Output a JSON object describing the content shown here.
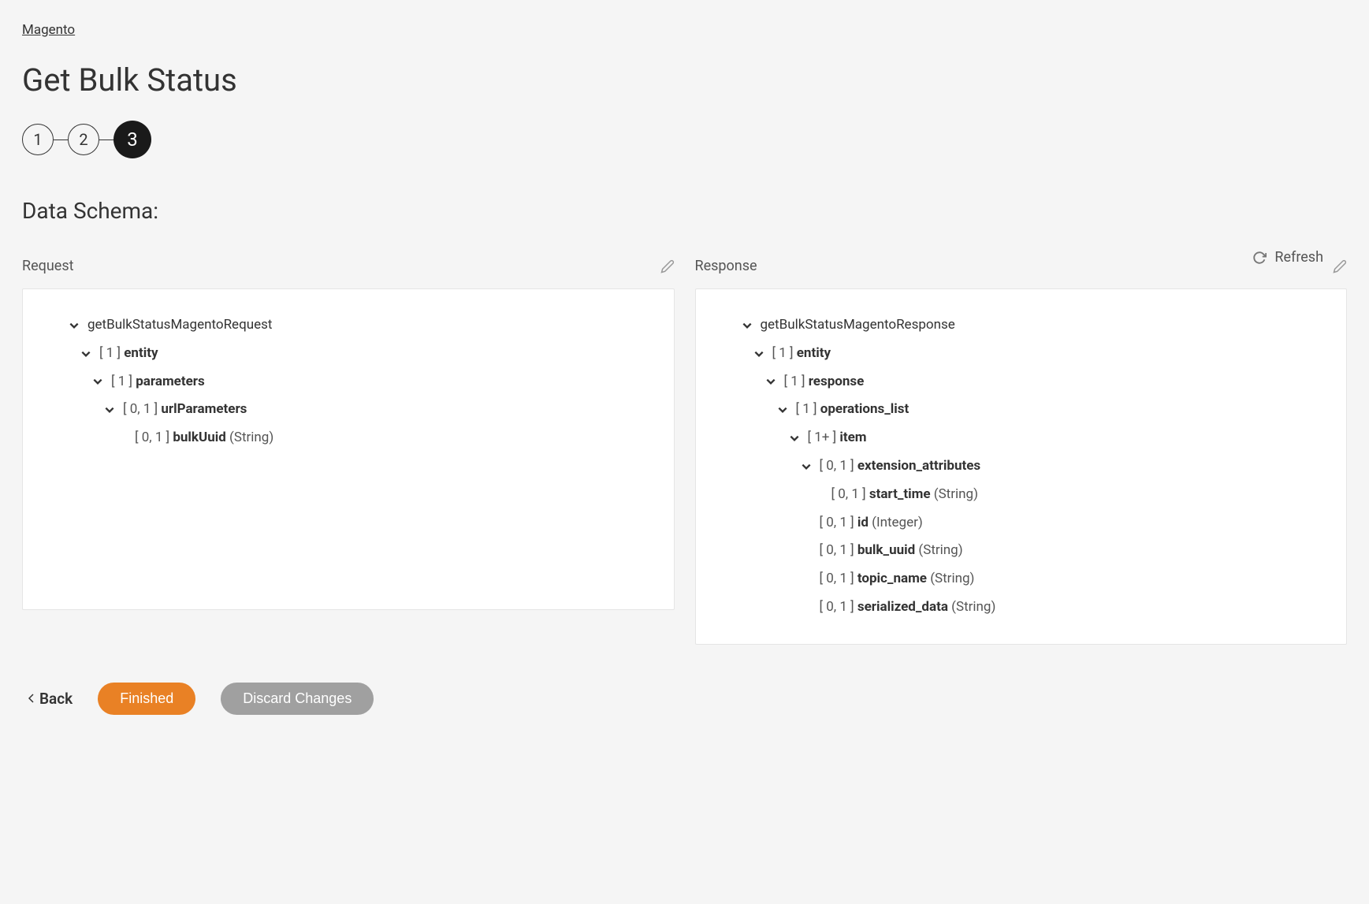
{
  "breadcrumb": "Magento",
  "page_title": "Get Bulk Status",
  "stepper": {
    "steps": [
      "1",
      "2",
      "3"
    ],
    "active_index": 2
  },
  "section_title": "Data Schema:",
  "refresh_label": "Refresh",
  "panels": {
    "request": {
      "title": "Request",
      "tree": [
        {
          "indent": 0,
          "chevron": true,
          "card": "",
          "name": "getBulkStatusMagentoRequest",
          "bold": false,
          "type": ""
        },
        {
          "indent": 1,
          "chevron": true,
          "card": "[ 1 ]",
          "name": "entity",
          "bold": true,
          "type": ""
        },
        {
          "indent": 2,
          "chevron": true,
          "card": "[ 1 ]",
          "name": "parameters",
          "bold": true,
          "type": ""
        },
        {
          "indent": 3,
          "chevron": true,
          "card": "[ 0, 1 ]",
          "name": "urlParameters",
          "bold": true,
          "type": ""
        },
        {
          "indent": 4,
          "chevron": false,
          "card": "[ 0, 1 ]",
          "name": "bulkUuid",
          "bold": true,
          "type": "(String)"
        }
      ]
    },
    "response": {
      "title": "Response",
      "tree": [
        {
          "indent": 0,
          "chevron": true,
          "card": "",
          "name": "getBulkStatusMagentoResponse",
          "bold": false,
          "type": ""
        },
        {
          "indent": 1,
          "chevron": true,
          "card": "[ 1 ]",
          "name": "entity",
          "bold": true,
          "type": ""
        },
        {
          "indent": 2,
          "chevron": true,
          "card": "[ 1 ]",
          "name": "response",
          "bold": true,
          "type": ""
        },
        {
          "indent": 3,
          "chevron": true,
          "card": "[ 1 ]",
          "name": "operations_list",
          "bold": true,
          "type": ""
        },
        {
          "indent": 4,
          "chevron": true,
          "card": "[ 1+ ]",
          "name": "item",
          "bold": true,
          "type": ""
        },
        {
          "indent": 5,
          "chevron": true,
          "card": "[ 0, 1 ]",
          "name": "extension_attributes",
          "bold": true,
          "type": ""
        },
        {
          "indent": 6,
          "chevron": false,
          "card": "[ 0, 1 ]",
          "name": "start_time",
          "bold": true,
          "type": "(String)"
        },
        {
          "indent": 5,
          "chevron": false,
          "card": "[ 0, 1 ]",
          "name": "id",
          "bold": true,
          "type": "(Integer)"
        },
        {
          "indent": 5,
          "chevron": false,
          "card": "[ 0, 1 ]",
          "name": "bulk_uuid",
          "bold": true,
          "type": "(String)"
        },
        {
          "indent": 5,
          "chevron": false,
          "card": "[ 0, 1 ]",
          "name": "topic_name",
          "bold": true,
          "type": "(String)"
        },
        {
          "indent": 5,
          "chevron": false,
          "card": "[ 0, 1 ]",
          "name": "serialized_data",
          "bold": true,
          "type": "(String)"
        }
      ]
    }
  },
  "footer": {
    "back": "Back",
    "finished": "Finished",
    "discard": "Discard Changes"
  }
}
